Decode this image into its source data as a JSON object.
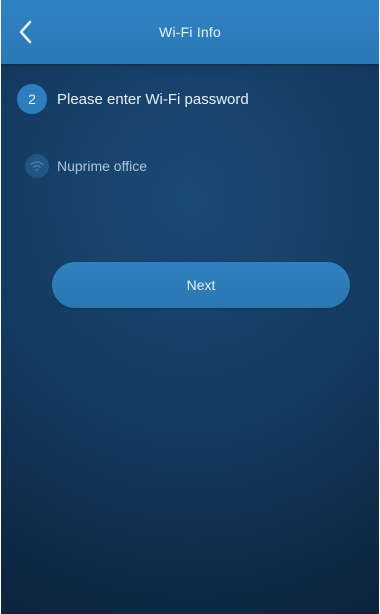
{
  "header": {
    "title": "Wi-Fi Info",
    "back_icon": "chevron-left-icon"
  },
  "step": {
    "number": "2",
    "text": "Please enter Wi-Fi password"
  },
  "network": {
    "name": "Nuprime office",
    "icon": "wifi-icon"
  },
  "actions": {
    "next_label": "Next"
  },
  "colors": {
    "accent": "#2c7ebf",
    "header": "#2f83c2",
    "background_top": "#1a4a76",
    "background_bottom": "#0a1a2e"
  }
}
